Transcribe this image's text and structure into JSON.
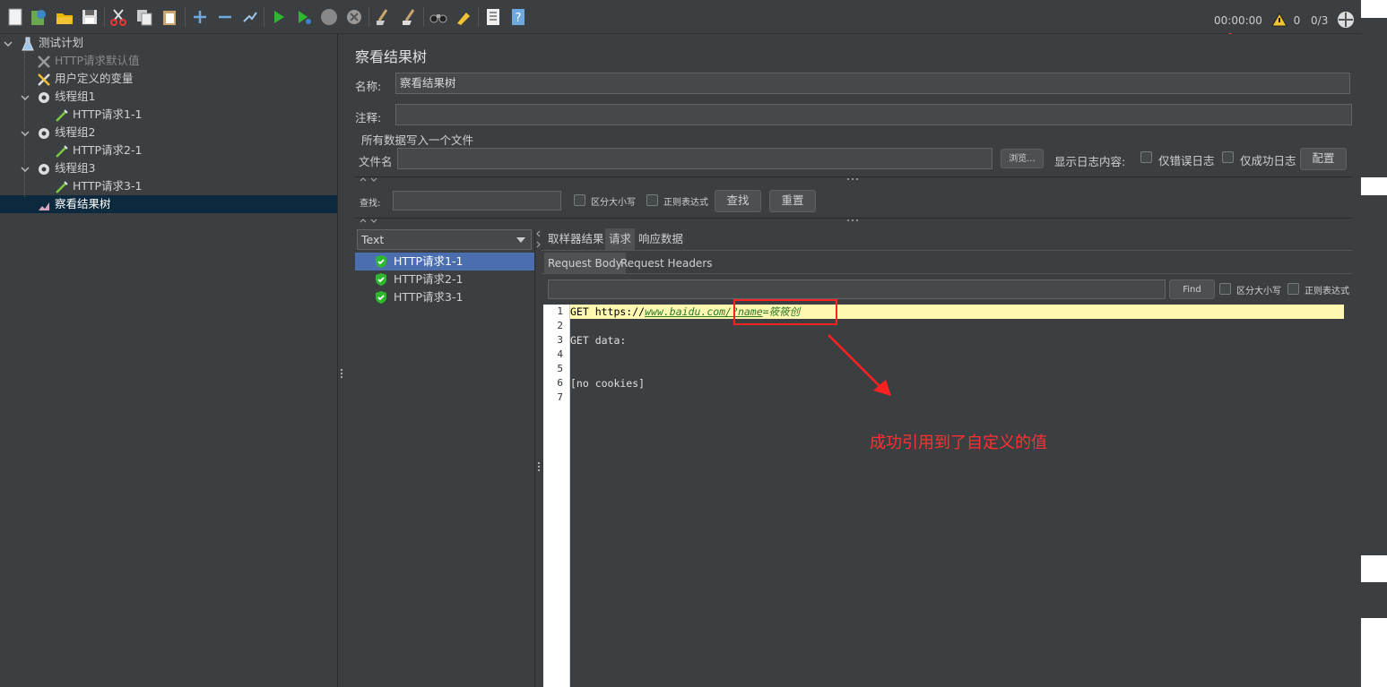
{
  "toolbar": {
    "icons": [
      "new-icon",
      "templates-icon",
      "open-icon",
      "save-icon",
      "cut-icon",
      "copy-icon",
      "paste-icon",
      "expand-icon",
      "collapse-icon",
      "toggle-icon",
      "start-icon",
      "start-no-pause-icon",
      "stop-icon",
      "shutdown-icon",
      "clear-icon",
      "clear-all-icon",
      "search-icon",
      "reset-search-icon",
      "function-helper-icon",
      "help-icon"
    ],
    "timer": "00:00:00",
    "warnings": "0",
    "threads": "0/3"
  },
  "tree": {
    "items": [
      {
        "label": "测试计划",
        "icon": "flask-icon"
      },
      {
        "label": "HTTP请求默认值",
        "icon": "wrench-icon"
      },
      {
        "label": "用户定义的变量",
        "icon": "wrench-icon"
      },
      {
        "label": "线程组1",
        "icon": "gear-icon"
      },
      {
        "label": "HTTP请求1-1",
        "icon": "pipette-icon"
      },
      {
        "label": "线程组2",
        "icon": "gear-icon"
      },
      {
        "label": "HTTP请求2-1",
        "icon": "pipette-icon"
      },
      {
        "label": "线程组3",
        "icon": "gear-icon"
      },
      {
        "label": "HTTP请求3-1",
        "icon": "pipette-icon"
      },
      {
        "label": "察看结果树",
        "icon": "chart-icon"
      }
    ]
  },
  "panel": {
    "title": "察看结果树",
    "name_label": "名称:",
    "name_value": "察看结果树",
    "comment_label": "注释:",
    "comment_value": "",
    "file_section": "所有数据写入一个文件",
    "file_label": "文件名",
    "file_value": "",
    "browse": "浏览...",
    "log_label": "显示日志内容:",
    "errors_only": "仅错误日志",
    "success_only": "仅成功日志",
    "configure": "配置",
    "search_label": "查找:",
    "search_value": "",
    "case_sensitive": "区分大小写",
    "regex": "正则表达式",
    "find_btn": "查找",
    "reset_btn": "重置"
  },
  "results": {
    "renderer": "Text",
    "items": [
      "HTTP请求1-1",
      "HTTP请求2-1",
      "HTTP请求3-1"
    ]
  },
  "tabs": [
    "取样器结果",
    "请求",
    "响应数据"
  ],
  "subtabs": [
    "Request Body",
    "Request Headers"
  ],
  "body_search": {
    "value": "",
    "find": "Find",
    "case_sensitive": "区分大小写",
    "regex": "正则表达式"
  },
  "editor": {
    "line_numbers": [
      "1",
      "2",
      "3",
      "4",
      "5",
      "6",
      "7"
    ],
    "line1_prefix": "GET https://",
    "line1_url": "www.baidu.com/",
    "line1_param": "?name",
    "line1_eq": "=筱筱创",
    "line3": "GET data:",
    "line6": "[no cookies]"
  },
  "annotation": {
    "text": "成功引用到了自定义的值"
  }
}
